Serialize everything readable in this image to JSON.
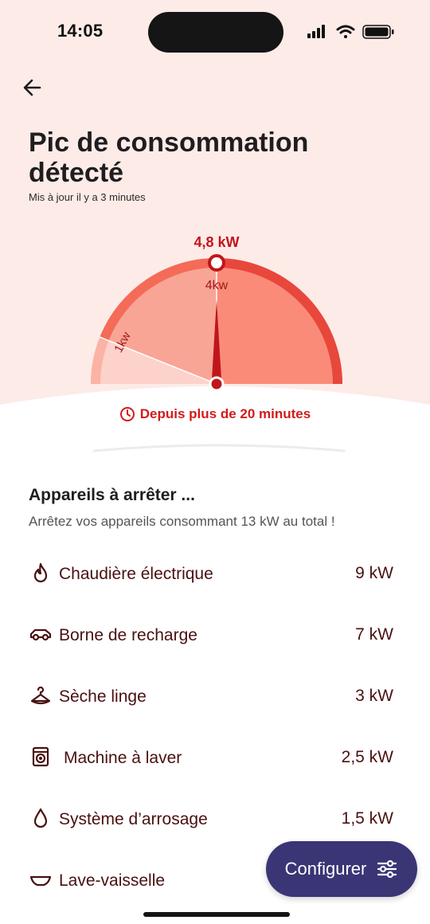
{
  "status_bar": {
    "time": "14:05"
  },
  "header": {
    "title": "Pic de consommation détecté",
    "updated": "Mis à jour il y a 3 minutes"
  },
  "gauge": {
    "current_value_label": "4,8 kW",
    "current_value_kw": 4.8,
    "threshold_high_label": "4kw",
    "threshold_low_label": "1kw",
    "colors": {
      "high": "#e8473c",
      "mid": "#f8a596",
      "low": "#fcd2ca",
      "needle": "#c0161b"
    }
  },
  "alert": {
    "since": "Depuis plus de 20 minutes"
  },
  "devices_section": {
    "title": "Appareils à arrêter ...",
    "subtitle": "Arrêtez vos appareils consommant 13 kW au total !",
    "items": [
      {
        "name": "Chaudière électrique",
        "power": "9 kW",
        "icon": "flame-icon"
      },
      {
        "name": "Borne de recharge",
        "power": "7 kW",
        "icon": "car-icon"
      },
      {
        "name": "Sèche linge",
        "power": "3 kW",
        "icon": "hanger-icon"
      },
      {
        "name": "Machine à laver",
        "power": "2,5 kW",
        "icon": "washing-machine-icon"
      },
      {
        "name": "Système d’arrosage",
        "power": "1,5 kW",
        "icon": "water-drop-icon"
      },
      {
        "name": "Lave-vaisselle",
        "power": "",
        "icon": "dish-icon"
      }
    ]
  },
  "fab": {
    "label": "Configurer",
    "icon": "sliders-icon"
  }
}
